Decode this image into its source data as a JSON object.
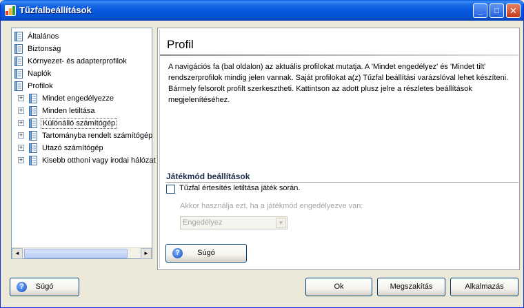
{
  "window": {
    "title": "Tűzfalbeállítások",
    "controls": {
      "minimize": "_",
      "maximize": "□",
      "close": "✕"
    }
  },
  "tree": {
    "items": [
      {
        "label": "Általános",
        "level": 0,
        "expandable": false,
        "selected": false
      },
      {
        "label": "Biztonság",
        "level": 0,
        "expandable": false,
        "selected": false
      },
      {
        "label": "Környezet- és adapterprofilok",
        "level": 0,
        "expandable": false,
        "selected": false
      },
      {
        "label": "Naplók",
        "level": 0,
        "expandable": false,
        "selected": false
      },
      {
        "label": "Profilok",
        "level": 0,
        "expandable": false,
        "selected": false
      },
      {
        "label": "Mindet engedélyezze",
        "level": 1,
        "expandable": true,
        "selected": false
      },
      {
        "label": "Minden letiltása",
        "level": 1,
        "expandable": true,
        "selected": false
      },
      {
        "label": "Különálló számítógép",
        "level": 1,
        "expandable": true,
        "selected": true
      },
      {
        "label": "Tartományba rendelt számítógép",
        "level": 1,
        "expandable": true,
        "selected": false
      },
      {
        "label": "Utazó számítógép",
        "level": 1,
        "expandable": true,
        "selected": false
      },
      {
        "label": "Kisebb otthoni vagy irodai hálózat",
        "level": 1,
        "expandable": true,
        "selected": false
      }
    ],
    "scroll_left": "◄",
    "scroll_right": "►"
  },
  "main": {
    "title": "Profil",
    "description": "A navigációs fa (bal oldalon) az aktuális profilokat mutatja. A 'Mindet engedélyez' és 'Mindet tilt' rendszerprofilok mindig jelen vannak. Saját profilokat a(z) Tűzfal beállítási varázslóval lehet készíteni. Bármely felsorolt profilt szerkesztheti. Kattintson az adott plusz jelre a részletes beállítások megjelenítéséhez.",
    "game_mode": {
      "section_title": "Játékmód beállítások",
      "checkbox_label": "Tűzfal értesítés letiltása játék során.",
      "checkbox_checked": false,
      "disabled_label": "Akkor használja ezt, ha a játékmód engedélyezve van:",
      "combo_value": "Engedélyez",
      "combo_arrow": "▼"
    },
    "help_button": "Súgó"
  },
  "footer": {
    "help": "Súgó",
    "ok": "Ok",
    "cancel": "Megszakítás",
    "apply": "Alkalmazás"
  },
  "icons": {
    "help_glyph": "?",
    "expand_glyph": "+"
  }
}
